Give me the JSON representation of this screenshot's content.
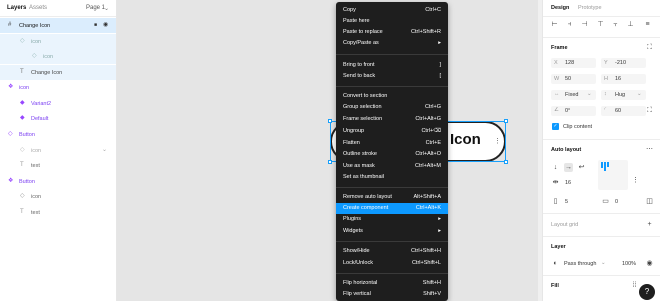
{
  "left_panel": {
    "tabs": {
      "layers": "Layers",
      "assets": "Assets",
      "page": "Page 1"
    },
    "layers": [
      {
        "icon": "#",
        "label": "Change Icon"
      },
      {
        "icon": "◇",
        "label": "icon"
      },
      {
        "icon": "◇",
        "label": "icon"
      },
      {
        "icon": "T",
        "label": "Change Icon"
      },
      {
        "icon": "❖",
        "label": "icon"
      },
      {
        "icon": "◆",
        "label": "Variant2"
      },
      {
        "icon": "◆",
        "label": "Default"
      },
      {
        "icon": "◇",
        "label": "Button"
      },
      {
        "icon": "◇",
        "label": "icon"
      },
      {
        "icon": "T",
        "label": "text"
      },
      {
        "icon": "❖",
        "label": "Button"
      },
      {
        "icon": "◇",
        "label": "icon"
      },
      {
        "icon": "T",
        "label": "text"
      }
    ]
  },
  "canvas": {
    "shape_text": "Icon",
    "more_glyph": "⋮"
  },
  "context_menu": {
    "items": [
      {
        "label": "Copy",
        "shortcut": "Ctrl+C"
      },
      {
        "label": "Paste here",
        "shortcut": ""
      },
      {
        "label": "Paste to replace",
        "shortcut": "Ctrl+Shift+R"
      },
      {
        "label": "Copy/Paste as",
        "shortcut": "▸"
      },
      {
        "label": "Bring to front",
        "shortcut": "]"
      },
      {
        "label": "Send to back",
        "shortcut": "["
      },
      {
        "label": "Convert to section",
        "shortcut": ""
      },
      {
        "label": "Group selection",
        "shortcut": "Ctrl+G"
      },
      {
        "label": "Frame selection",
        "shortcut": "Ctrl+Alt+G"
      },
      {
        "label": "Ungroup",
        "shortcut": "Ctrl+⌫"
      },
      {
        "label": "Flatten",
        "shortcut": "Ctrl+E"
      },
      {
        "label": "Outline stroke",
        "shortcut": "Ctrl+Alt+O"
      },
      {
        "label": "Use as mask",
        "shortcut": "Ctrl+Alt+M"
      },
      {
        "label": "Set as thumbnail",
        "shortcut": ""
      },
      {
        "label": "Remove auto layout",
        "shortcut": "Alt+Shift+A"
      },
      {
        "label": "Create component",
        "shortcut": "Ctrl+Alt+K"
      },
      {
        "label": "Plugins",
        "shortcut": "▸"
      },
      {
        "label": "Widgets",
        "shortcut": "▸"
      },
      {
        "label": "Show/Hide",
        "shortcut": "Ctrl+Shift+H"
      },
      {
        "label": "Lock/Unlock",
        "shortcut": "Ctrl+Shift+L"
      },
      {
        "label": "Flip horizontal",
        "shortcut": "Shift+H"
      },
      {
        "label": "Flip vertical",
        "shortcut": "Shift+V"
      }
    ]
  },
  "right_panel": {
    "tabs": {
      "design": "Design",
      "prototype": "Prototype"
    },
    "frame": {
      "title": "Frame",
      "x_label": "X",
      "x": "128",
      "y_label": "Y",
      "y": "-210",
      "w_label": "W",
      "w": "50",
      "h_label": "H",
      "h": "16",
      "fixed": "Fixed",
      "hug": "Hug",
      "rotation": "0°",
      "radius": "60",
      "clip": "Clip content"
    },
    "auto_layout": {
      "title": "Auto layout",
      "gap": "16",
      "padding_h": "5",
      "padding_v": "0"
    },
    "layout_grid": {
      "title": "Layout grid"
    },
    "layer": {
      "title": "Layer",
      "blend": "Pass through",
      "opacity": "100%"
    },
    "fill": {
      "title": "Fill"
    },
    "help": "?"
  }
}
